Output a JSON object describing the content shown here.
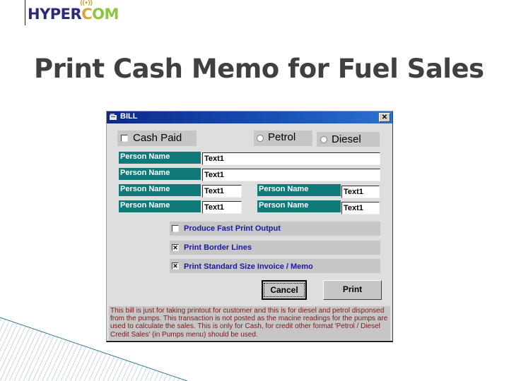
{
  "logo": {
    "part1": "HYPER",
    "part2": "C",
    "part3": "OM",
    "signal_icon": "wifi-signal-icon"
  },
  "slide": {
    "title": "Print Cash Memo for Fuel Sales"
  },
  "dialog": {
    "title": "BILL",
    "close_label": "✕",
    "cash_paid": {
      "label": "Cash Paid",
      "checked": false
    },
    "fuel_type": {
      "options": [
        {
          "label": "Petrol",
          "selected": false
        },
        {
          "label": "Diesel",
          "selected": false
        }
      ]
    },
    "fields": [
      {
        "label": "Person Name",
        "value": "Text1"
      },
      {
        "label": "Person Name",
        "value": "Text1"
      },
      {
        "label": "Person Name",
        "value": "Text1"
      },
      {
        "label": "Person Name",
        "value": "Text1"
      },
      {
        "label": "Person Name",
        "value": "Text1"
      },
      {
        "label": "Person Name",
        "value": "Text1"
      }
    ],
    "options": [
      {
        "label": "Produce Fast Print Output",
        "checked": false,
        "mark": ""
      },
      {
        "label": "Print Border Lines",
        "checked": true,
        "mark": "✕"
      },
      {
        "label": "Print Standard Size Invoice / Memo",
        "checked": true,
        "mark": "✕"
      }
    ],
    "buttons": {
      "cancel": "Cancel",
      "print": "Print"
    },
    "info_text": "This bill is just for taking printout for customer and this is for diesel and petrol disponsed from the pumps. This transaction is not posted as the macine readings for the pumps are used to calculate the sales. This is only for Cash, for credit other format 'Petrol / Diesel Credit Sales' (in Pumps menu) should be used.",
    "colors": {
      "titlebar": "#0a2a8a",
      "label_bg": "#0f7a78",
      "option_text": "#1a1aa0",
      "info_text": "#7a1a1a"
    }
  }
}
